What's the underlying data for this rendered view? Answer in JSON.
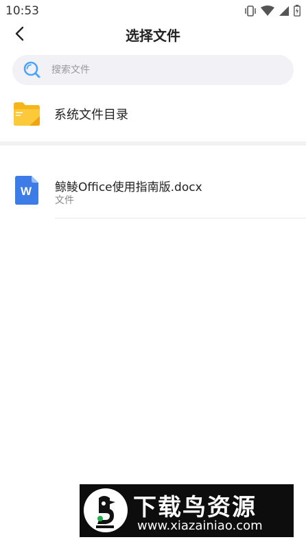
{
  "status_bar": {
    "time": "10:53",
    "icons": [
      "vibrate-icon",
      "wifi-icon",
      "signal-icon",
      "battery-icon"
    ]
  },
  "header": {
    "title": "选择文件",
    "back_icon": "chevron-left-icon"
  },
  "search": {
    "placeholder": "搜索文件",
    "icon": "search-icon"
  },
  "system_directory": {
    "label": "系统文件目录",
    "icon": "folder-icon"
  },
  "files": [
    {
      "name": "鲸鲮Office使用指南版.docx",
      "type": "文件",
      "icon": "word-document-icon"
    }
  ],
  "watermark": {
    "title": "下载鸟资源",
    "url": "www.xiazainiao.com"
  },
  "colors": {
    "folder": "#f7b51c",
    "word_blue": "#3d7be6",
    "search_bg": "#f1f1f6",
    "search_icon": "#4aa3ff"
  }
}
